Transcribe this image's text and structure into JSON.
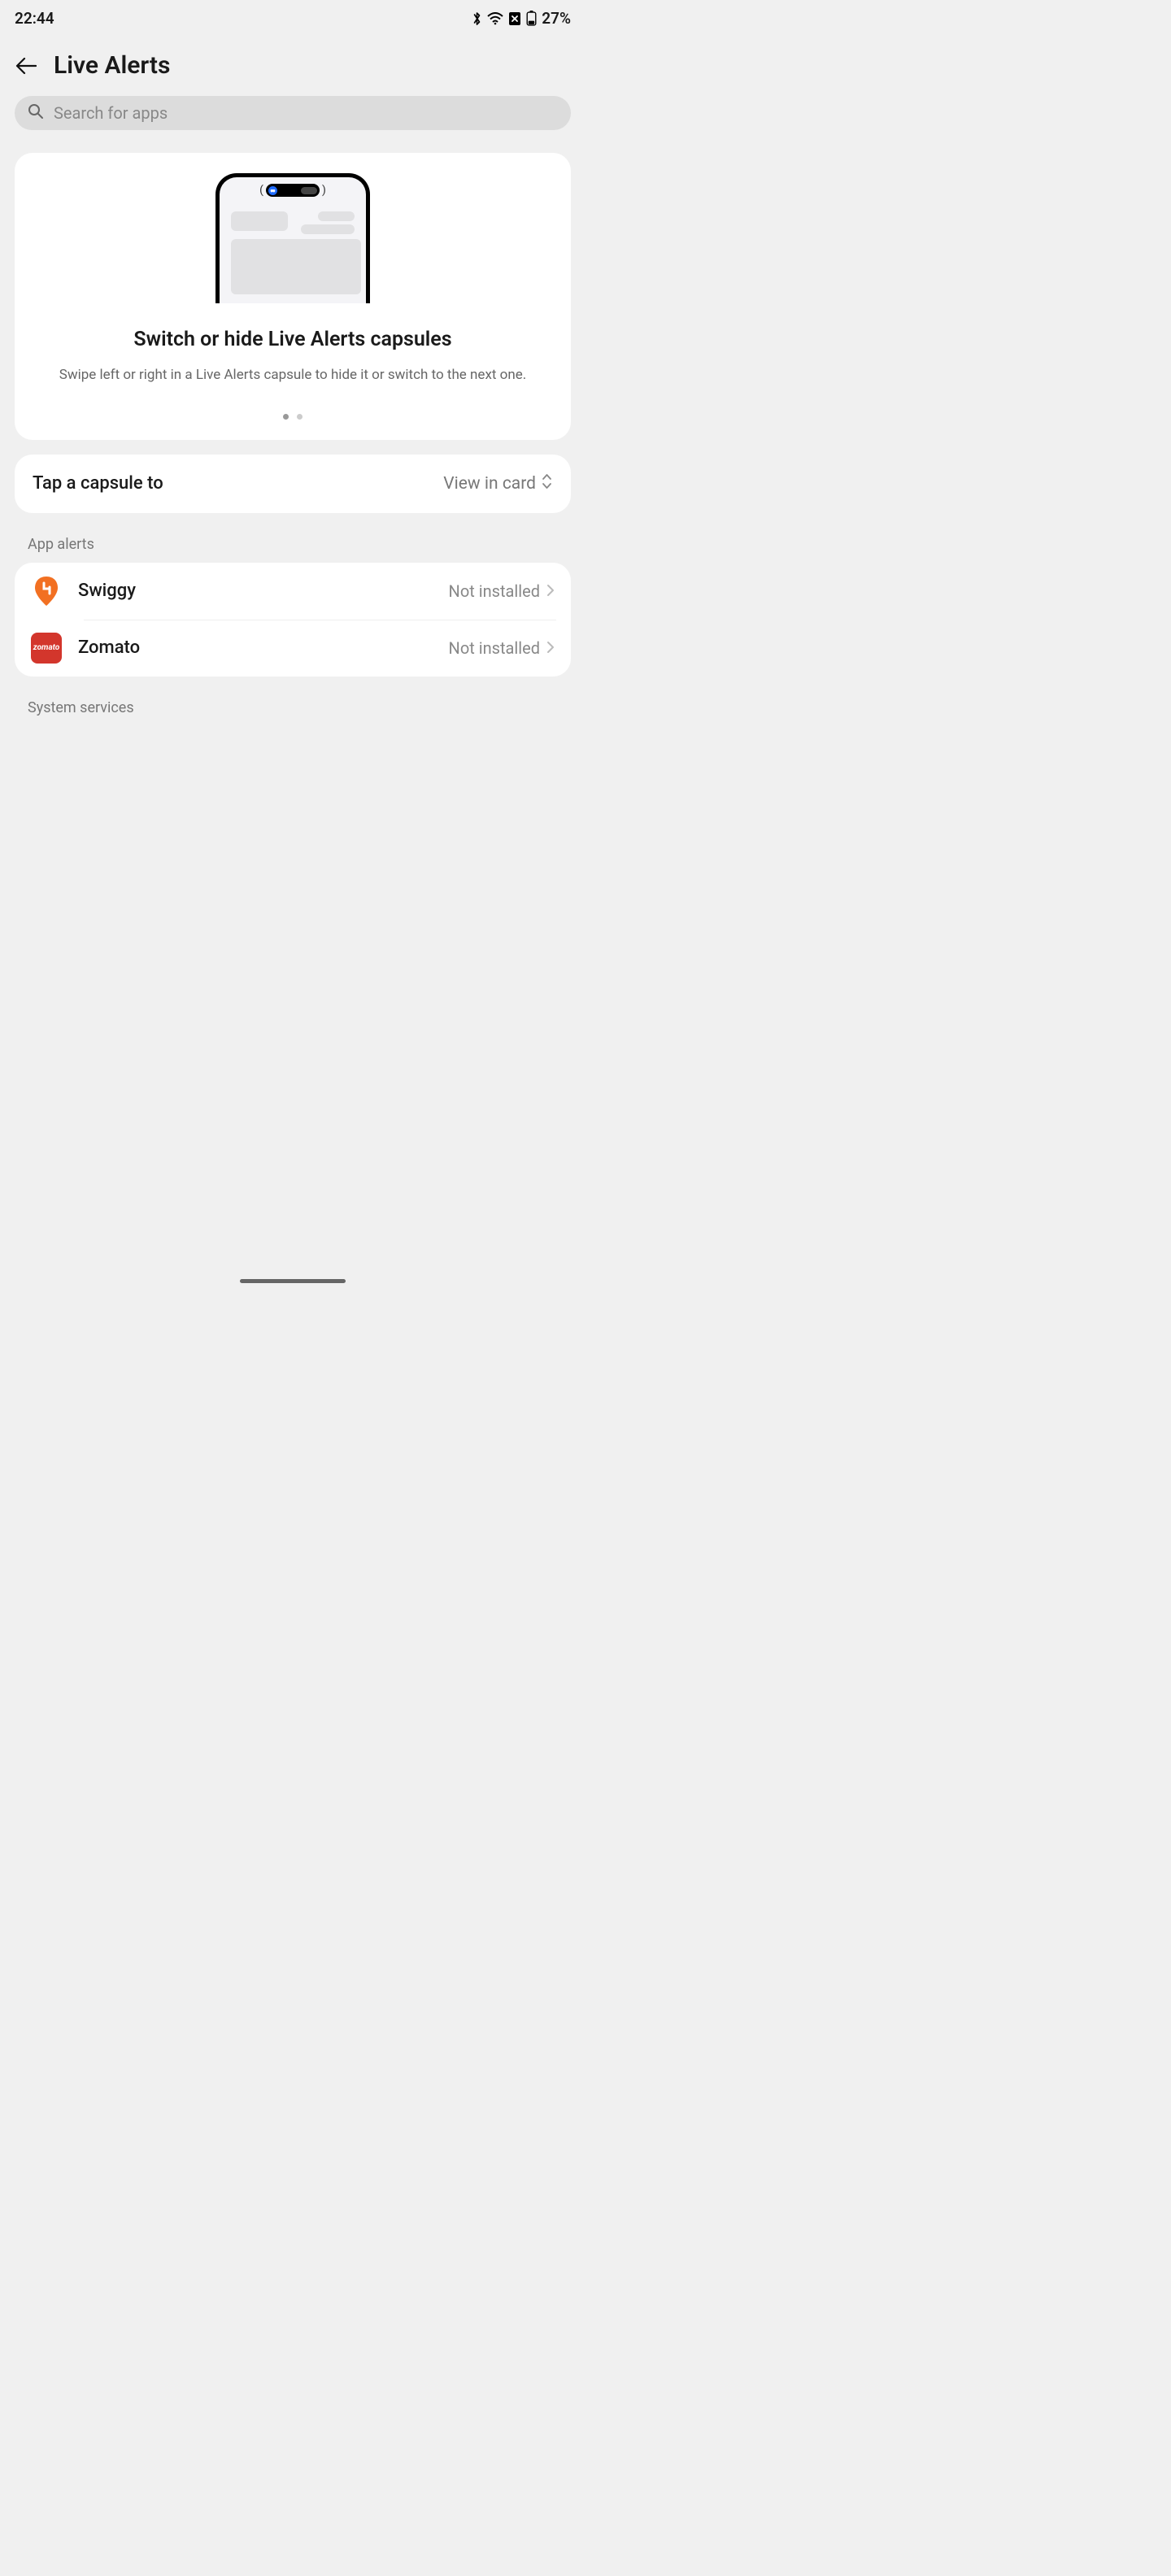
{
  "status": {
    "time": "22:44",
    "battery_pct": "27%"
  },
  "header": {
    "title": "Live Alerts"
  },
  "search": {
    "placeholder": "Search for apps"
  },
  "info_card": {
    "title": "Switch or hide Live Alerts capsules",
    "description": "Swipe left or right in a Live Alerts capsule to hide it or switch to the next one."
  },
  "option": {
    "label": "Tap a capsule to",
    "value": "View in card"
  },
  "sections": {
    "app_alerts_header": "App alerts",
    "system_services_header": "System services"
  },
  "apps": [
    {
      "name": "Swiggy",
      "status": "Not installed"
    },
    {
      "name": "Zomato",
      "status": "Not installed"
    }
  ]
}
